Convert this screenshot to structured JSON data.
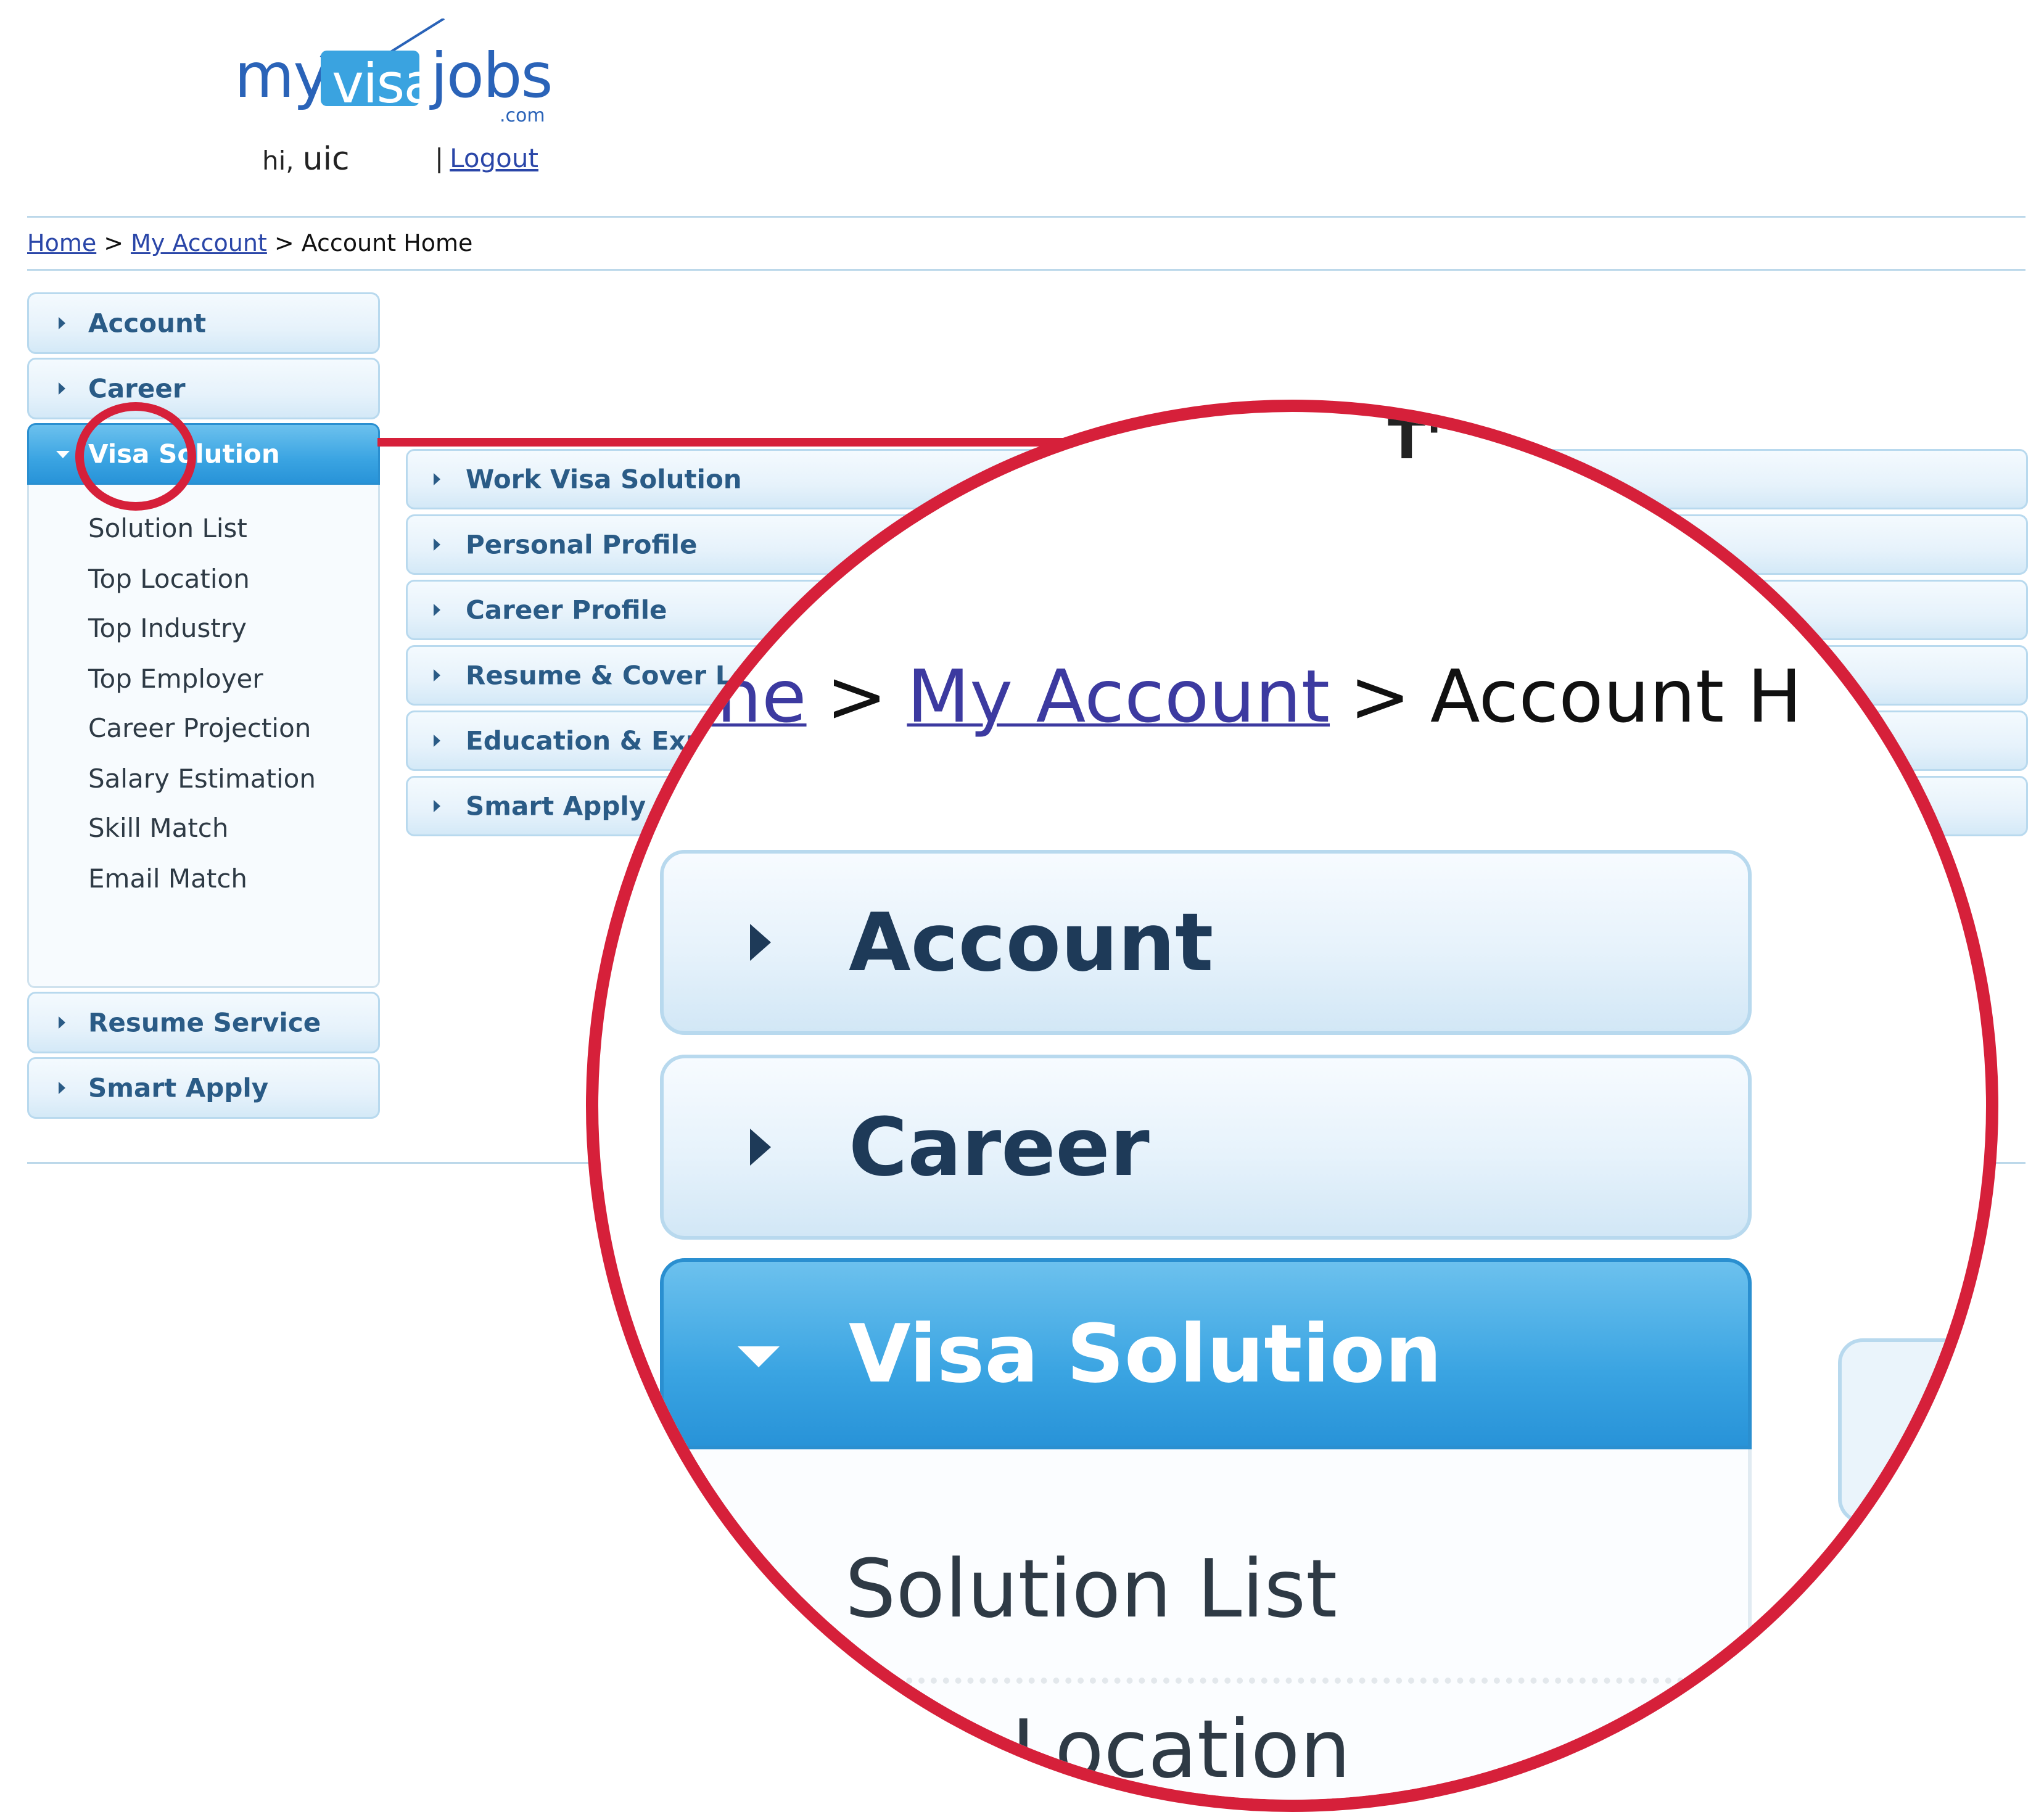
{
  "logo": {
    "my": "my",
    "visa": "visa",
    "jobs": "jobs",
    "com": ".com"
  },
  "header": {
    "greeting": "hi,",
    "username": "uic",
    "separator": "|",
    "logout_label": "Logout"
  },
  "breadcrumb": {
    "home": "Home",
    "sep": ">",
    "account": "My Account",
    "current": "Account Home"
  },
  "sidebar": {
    "top_items": [
      {
        "label": "Account"
      },
      {
        "label": "Career"
      },
      {
        "label": "Visa Solution"
      }
    ],
    "visa_submenu": [
      "Solution List",
      "Top Location",
      "Top Industry",
      "Top Employer",
      "Career Projection",
      "Salary Estimation",
      "Skill Match",
      "Email Match"
    ],
    "bottom_items": [
      {
        "label": "Resume Service"
      },
      {
        "label": "Smart Apply"
      }
    ]
  },
  "main_menu": [
    {
      "label": "Work Visa Solution"
    },
    {
      "label": "Personal Profile"
    },
    {
      "label": "Career Profile"
    },
    {
      "label": "Resume & Cover Let"
    },
    {
      "label": "Education & Exp"
    },
    {
      "label": "Smart Apply"
    }
  ],
  "zoom": {
    "crumb_home": "me",
    "crumb_sep": ">",
    "crumb_account": "My Account",
    "crumb_current": "Account H",
    "items": [
      "Account",
      "Career",
      "Visa Solution"
    ],
    "sub_items": [
      "Solution List",
      "Location"
    ]
  },
  "colors": {
    "callout": "#d6203a",
    "active": "#3aa4e2",
    "link": "#2a46a8"
  }
}
